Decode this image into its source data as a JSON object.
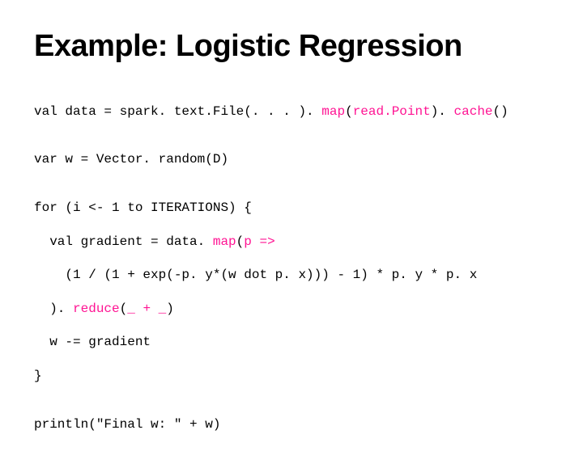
{
  "title": "Example: Logistic Regression",
  "code": {
    "l1a": "val data = spark. text.File(. . . ). ",
    "l1b": "map",
    "l1c": "(",
    "l1d": "read.Point",
    "l1e": "). ",
    "l1f": "cache",
    "l1g": "()",
    "l2": "var w = Vector. random(D)",
    "l3": "for (i <- 1 to ITERATIONS) {",
    "l4a": "  val gradient = data. ",
    "l4b": "map",
    "l4c": "(",
    "l4d": "p =>",
    "l5": "    (1 / (1 + exp(-p. y*(w dot p. x))) - 1) * p. y * p. x",
    "l6a": "  ). ",
    "l6b": "reduce",
    "l6c": "(",
    "l6d": "_ + _",
    "l6e": ")",
    "l7": "  w -= gradient",
    "l8": "}",
    "l9": "println(\"Final w: \" + w)"
  }
}
